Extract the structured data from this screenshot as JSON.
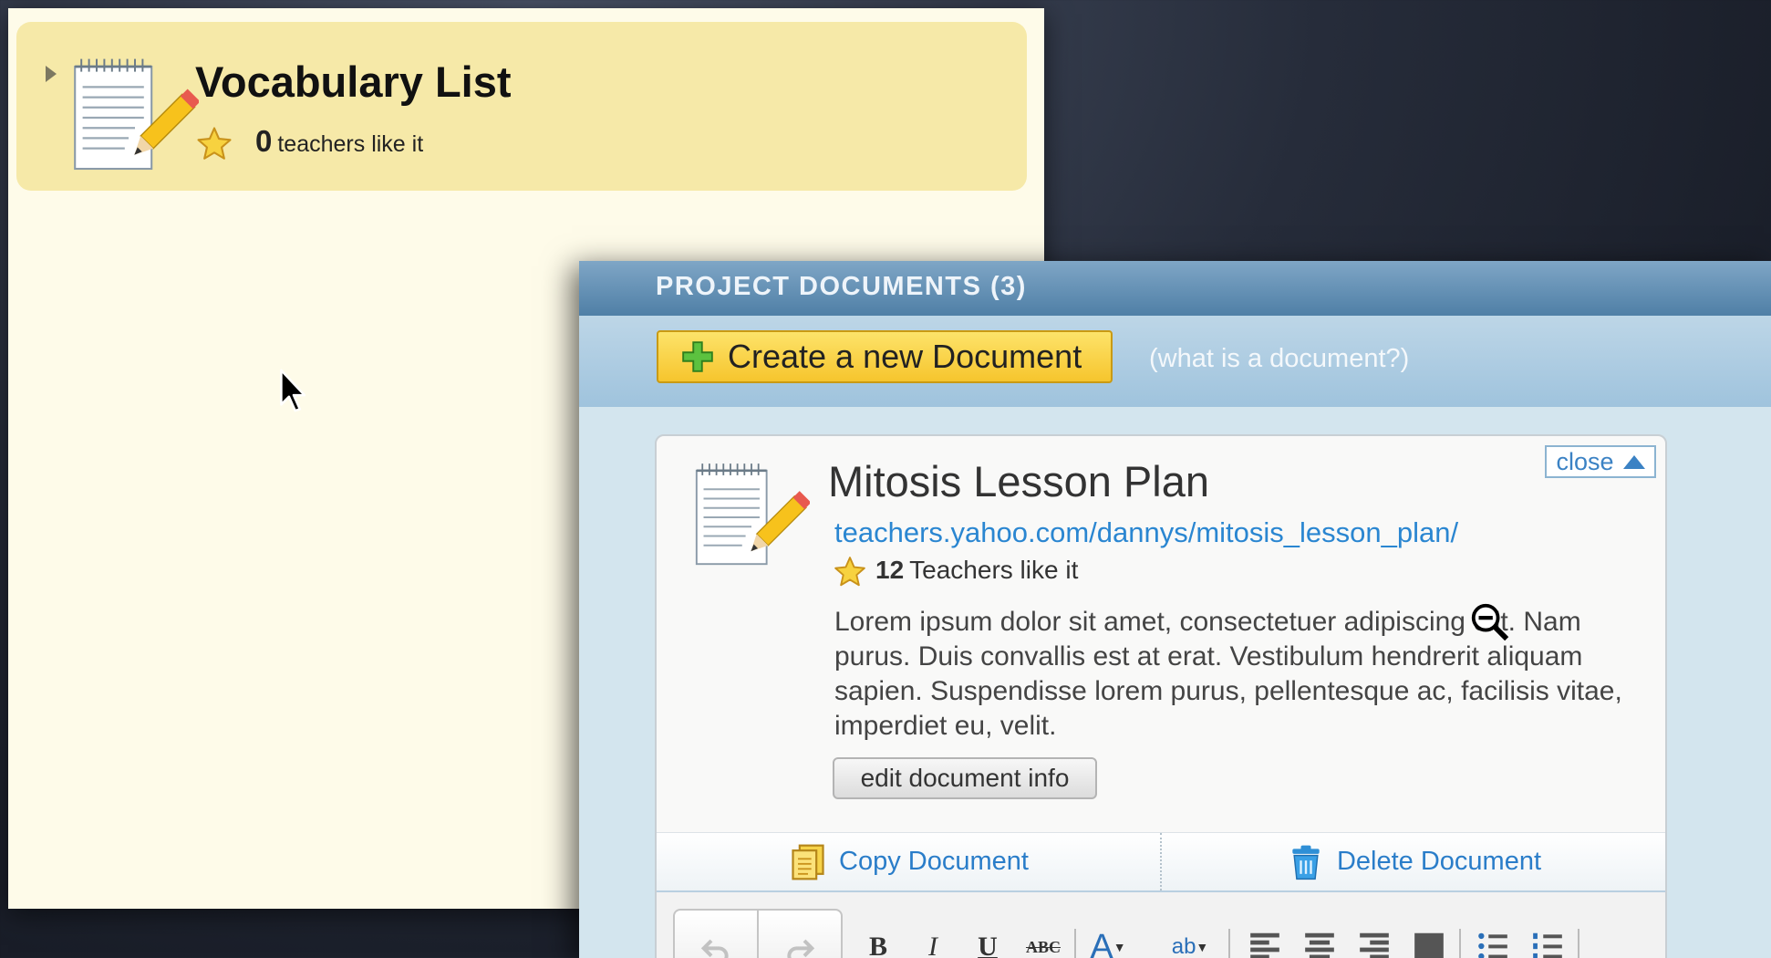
{
  "vocab": {
    "title": "Vocabulary List",
    "likes_count": "0",
    "likes_text": "teachers like it"
  },
  "panel": {
    "header": "PROJECT DOCUMENTS (3)",
    "create_button": "Create a new Document",
    "what_link": "(what is a document?)"
  },
  "document": {
    "close_label": "close",
    "title": "Mitosis Lesson Plan",
    "url": "teachers.yahoo.com/dannys/mitosis_lesson_plan/",
    "likes_count": "12",
    "likes_text": "Teachers like it",
    "description": "Lorem ipsum dolor sit amet, consectetuer adipiscing elit. Nam purus. Duis convallis est at erat. Vestibulum hendrerit aliquam sapien. Suspendisse lorem purus, pellentesque ac, facilisis vitae, imperdiet eu, velit.",
    "edit_button": "edit document info",
    "copy_action": "Copy Document",
    "delete_action": "Delete Document"
  },
  "editor_toolbar": {
    "bold": "B",
    "italic": "I",
    "underline": "U",
    "strike": "ABC",
    "font_color": "A",
    "highlight": "ab"
  },
  "colors": {
    "cream": "#fefbe9",
    "vocab_card": "#f6e9a8",
    "link_blue": "#2a86d1",
    "header_blue": "#4f7fa6",
    "button_yellow": "#f6c52d"
  },
  "icons": {
    "document": "notepad-pencil-icon",
    "star": "star-icon",
    "create": "green-plus-icon",
    "copy": "copy-icon",
    "delete": "trash-icon",
    "zoom": "zoom-out-icon",
    "cursor": "arrow-cursor-icon"
  }
}
